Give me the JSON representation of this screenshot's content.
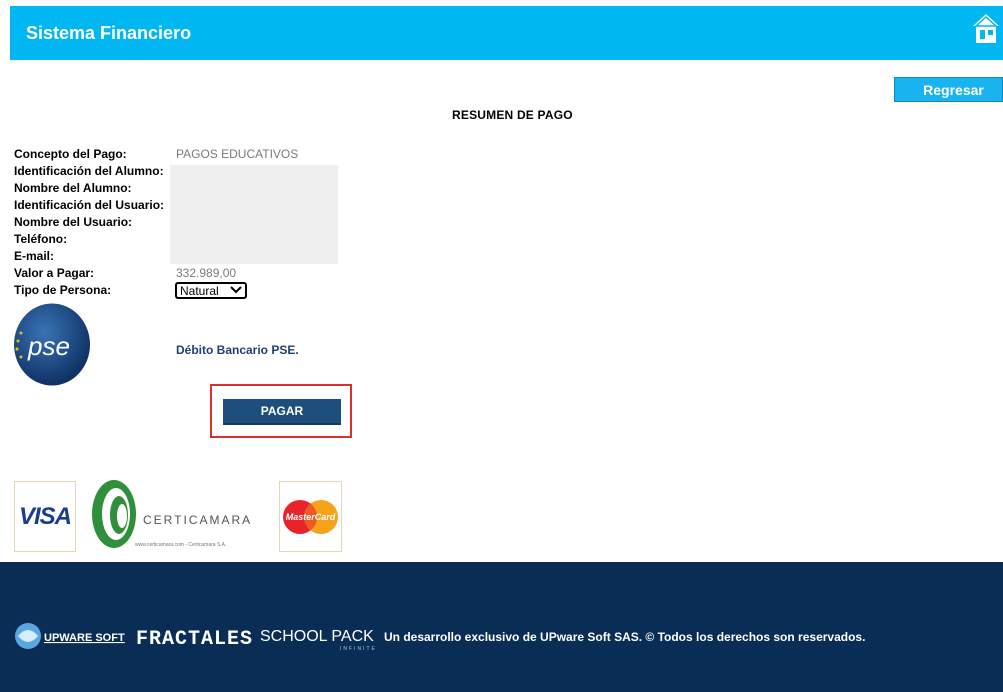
{
  "header": {
    "title": "Sistema Financiero",
    "home_icon": "home-icon"
  },
  "actions": {
    "back_label": "Regresar",
    "pay_label": "PAGAR"
  },
  "summary": {
    "title": "RESUMEN DE PAGO",
    "labels": {
      "concepto": "Concepto del Pago:",
      "id_alumno": "Identificación del Alumno:",
      "nombre_alumno": "Nombre del Alumno:",
      "id_usuario": "Identificación del Usuario:",
      "nombre_usuario": "Nombre del Usuario:",
      "telefono": "Teléfono:",
      "email": "E-mail:",
      "valor": "Valor a Pagar:",
      "tipo_persona": "Tipo de Persona:"
    },
    "values": {
      "concepto": "PAGOS EDUCATIVOS",
      "valor": "332.989,00",
      "tipo_persona": "Natural"
    }
  },
  "payment_method": {
    "logo_text": "pse",
    "label": "Débito Bancario PSE."
  },
  "brands": {
    "visa": "VISA",
    "certicamara": "CERTICAMARA",
    "certicamara_url": "www.certicamara.com - Certicamara S.A.",
    "mastercard": "MasterCard"
  },
  "footer": {
    "brand_upware": "UPWARE SOFT",
    "brand_fractales": "FRACTALES",
    "brand_schoolpack": "SCHOOL PACK",
    "brand_schoolpack_sub": "INFINITE",
    "text": "Un desarrollo exclusivo de UPware Soft SAS. © Todos los derechos son reservados."
  },
  "colors": {
    "header_bg": "#00b7f1",
    "footer_bg": "#0a2d55",
    "pay_button": "#1c4f7c",
    "highlight": "#d9302b"
  }
}
